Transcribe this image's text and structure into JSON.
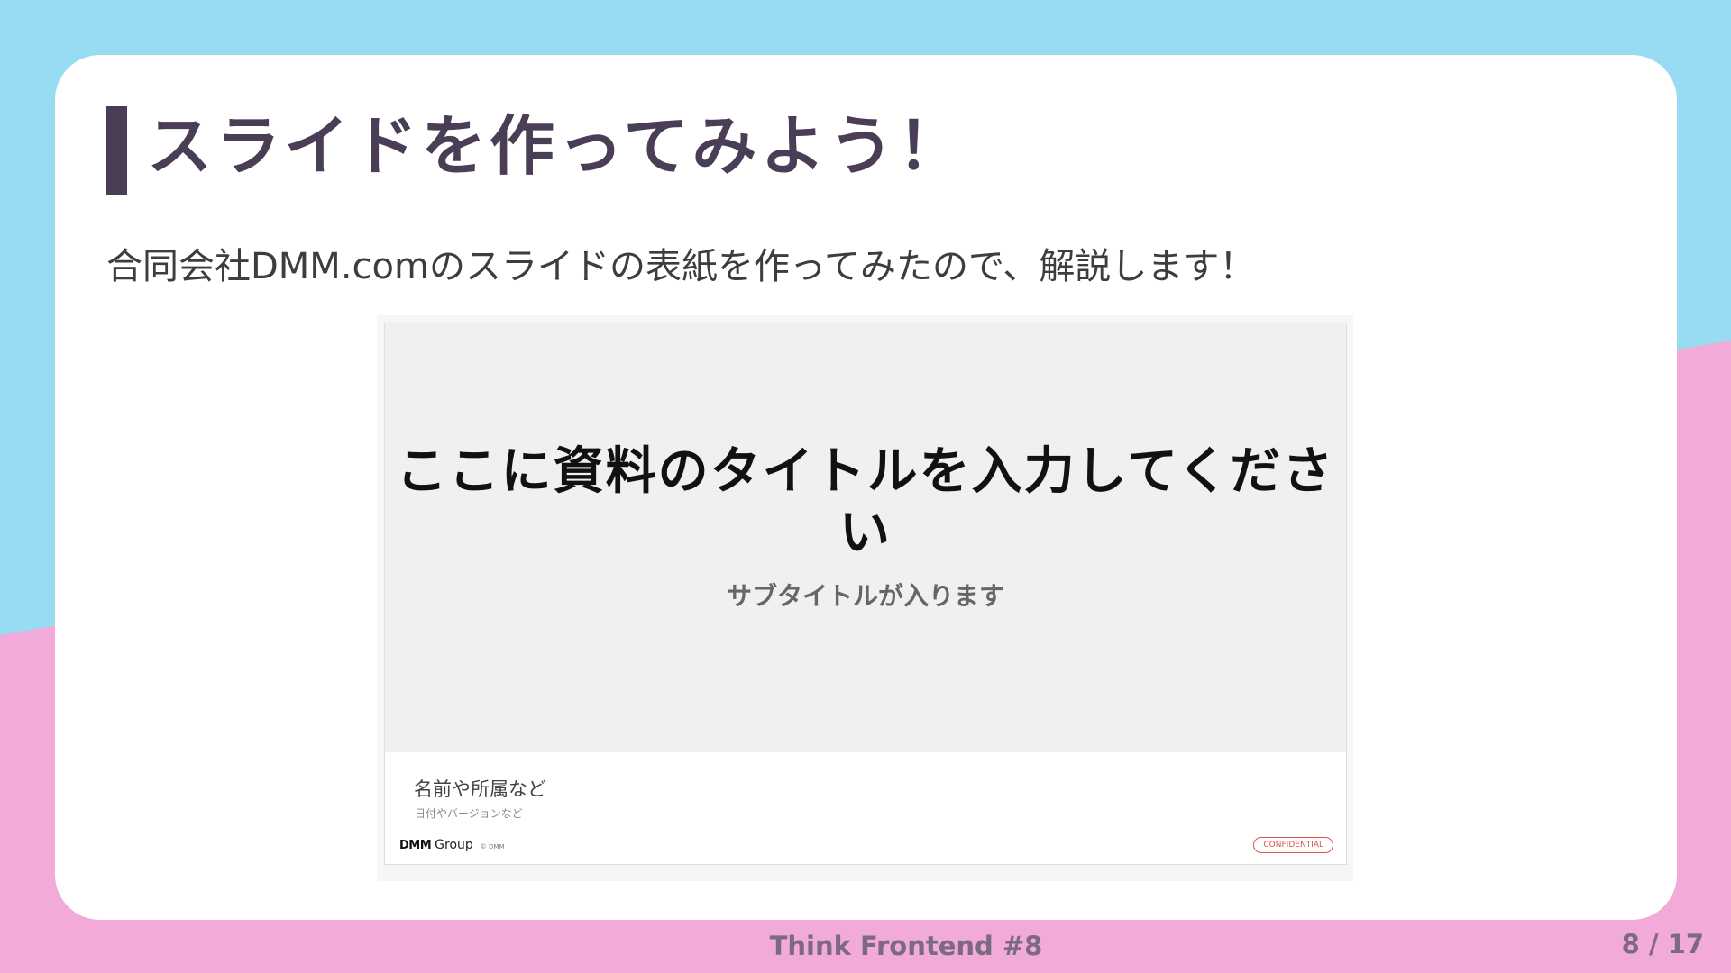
{
  "slide": {
    "title": "スライドを作ってみよう！",
    "lead": "合同会社DMM.comのスライドの表紙を作ってみたので、解説します！"
  },
  "preview": {
    "title": "ここに資料のタイトルを入力してください",
    "subtitle": "サブタイトルが入ります",
    "author": "名前や所属など",
    "date_version": "日付やバージョンなど",
    "logo_mark": "DMM",
    "logo_word": "Group",
    "copyright": "© DMM",
    "confidential": "CONFIDENTIAL"
  },
  "footer": {
    "event": "Think Frontend #8",
    "page": "8 / 17"
  },
  "colors": {
    "background_blue": "#97dcf2",
    "background_pink": "#f2aad8",
    "title_accent": "#4a3d56",
    "confidential_red": "#d9534f"
  }
}
